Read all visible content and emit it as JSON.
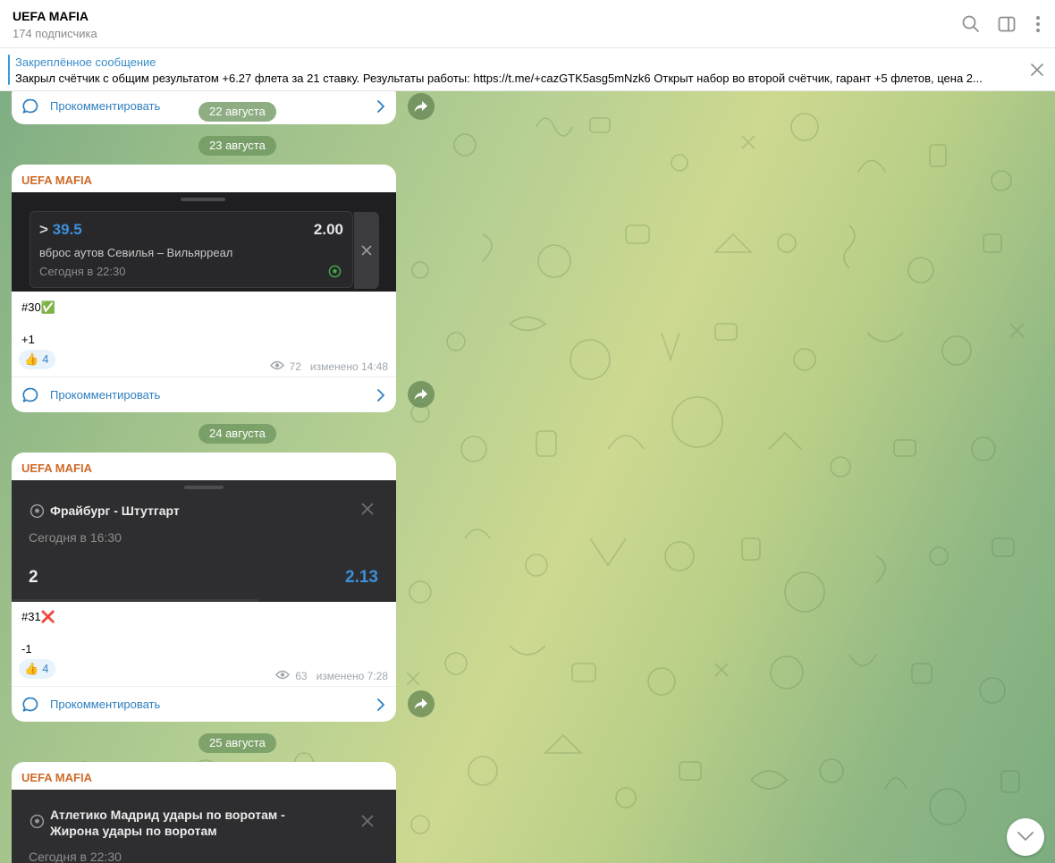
{
  "header": {
    "channel_name": "UEFA MAFIA",
    "subscribers": "174 подписчика",
    "icons": [
      "search-icon",
      "sidebar-toggle-icon",
      "more-vertical-icon"
    ]
  },
  "pinned": {
    "title": "Закреплённое сообщение",
    "text": "Закрыл счётчик с общим результатом +6.27 флета за 21 ставку. Результаты работы: https://t.me/+cazGTK5asg5mNzk6  Открыт набор во второй счётчик, гарант +5 флетов, цена 2..."
  },
  "colors": {
    "accent": "#3a8cc9",
    "author": "#cf6a28",
    "bet_highlight": "#3c8fd8"
  },
  "dates": {
    "aug22": "22 августа",
    "aug23": "23 августа",
    "aug24": "24 августа",
    "aug25": "25 августа"
  },
  "messages": [
    {
      "comment_label": "Прокомментировать"
    },
    {
      "author": "UEFA MAFIA",
      "bet": {
        "prefix": ">",
        "value": "39.5",
        "odds": "2.00",
        "name": "вброс аутов Севилья – Вильярреал",
        "time": "Сегодня в 22:30"
      },
      "tag": "#30✅",
      "result": "+1",
      "reaction_emoji": "👍",
      "reaction_count": "4",
      "views": "72",
      "edited": "изменено 14:48",
      "comment_label": "Прокомментировать"
    },
    {
      "author": "UEFA MAFIA",
      "bet": {
        "match": "Фрайбург - Штутгарт",
        "time": "Сегодня в 16:30",
        "pick": "2",
        "odds": "2.13"
      },
      "tag": "#31❌",
      "result": "-1",
      "reaction_emoji": "👍",
      "reaction_count": "4",
      "views": "63",
      "edited": "изменено 7:28",
      "comment_label": "Прокомментировать"
    },
    {
      "author": "UEFA MAFIA",
      "bet": {
        "match_line1": "Атлетико Мадрид удары по воротам -",
        "match_line2": "Жирона удары по воротам",
        "time": "Сегодня в 22:30"
      }
    }
  ]
}
